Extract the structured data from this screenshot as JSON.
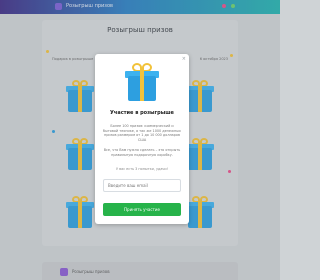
{
  "header": {
    "title": "Розыгрыш призов"
  },
  "page": {
    "title": "Розыгрыш призов",
    "legend_left": "Подарок в розыгрыше",
    "legend_right": "6 октября 2023"
  },
  "modal": {
    "close": "×",
    "title": "Участие в розыгрыше",
    "text1": "Более 100 призов: коммерческий и бытовой технике, а так же 1000 денежных призов размером от 1 до 10 000 долларов США",
    "text2": "Все, что Вам нужно сделать – это открыть правильную подарочную коробку.",
    "text3": "У вас есть 3 попытки, удачи!",
    "input_placeholder": "Введите ваш email",
    "button_label": "Принять участие"
  },
  "bottom": {
    "text": "Розыгрыш призов"
  },
  "colors": {
    "header_start": "#3f2d86",
    "header_end": "#23b3b0",
    "gift": "#2d9fe0",
    "ribbon": "#f2c23a",
    "primary_button": "#27b34a"
  }
}
